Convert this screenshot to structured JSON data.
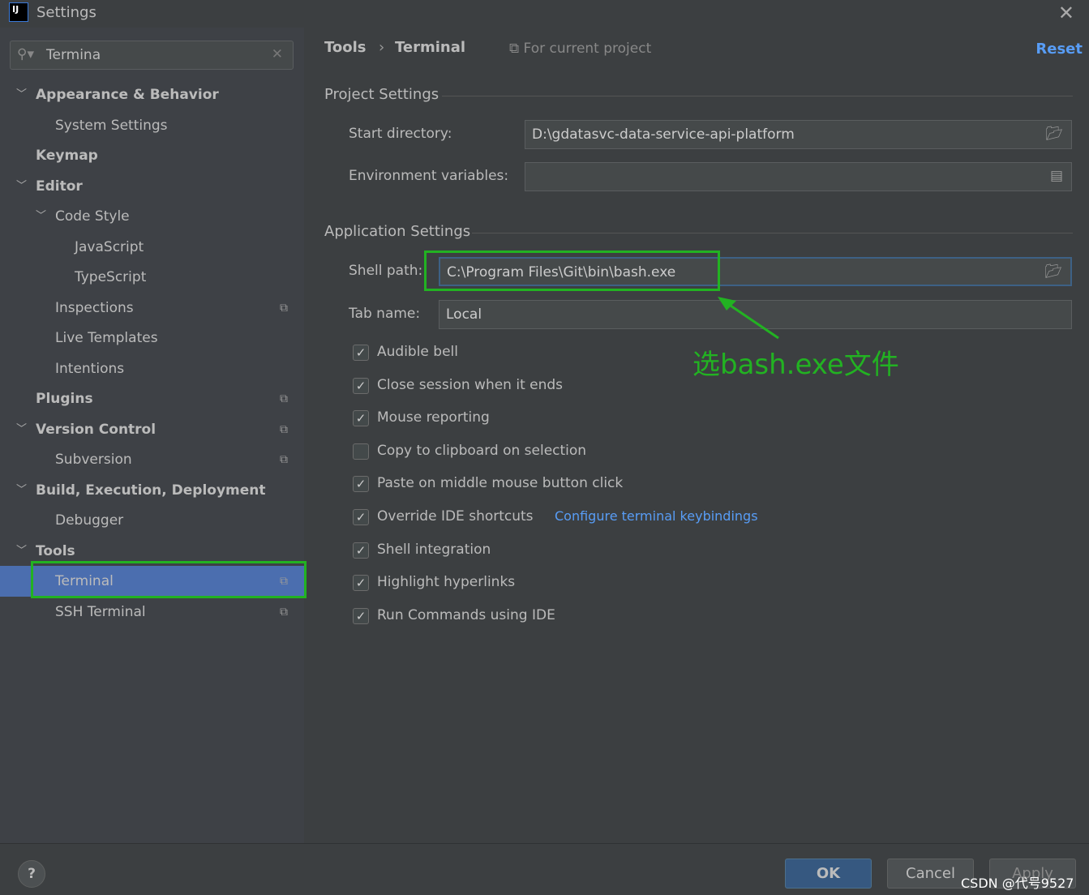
{
  "window": {
    "title": "Settings",
    "logo": "IJ"
  },
  "search": {
    "value": "Termina"
  },
  "tree": [
    {
      "label": "Appearance & Behavior",
      "level": 0,
      "expanded": true,
      "bold": true
    },
    {
      "label": "System Settings",
      "level": 1
    },
    {
      "label": "Keymap",
      "level": 0,
      "bold": true
    },
    {
      "label": "Editor",
      "level": 0,
      "expanded": true,
      "bold": true
    },
    {
      "label": "Code Style",
      "level": 1,
      "expanded": true
    },
    {
      "label": "JavaScript",
      "level": 2
    },
    {
      "label": "TypeScript",
      "level": 2
    },
    {
      "label": "Inspections",
      "level": 1,
      "copy": true
    },
    {
      "label": "Live Templates",
      "level": 1
    },
    {
      "label": "Intentions",
      "level": 1
    },
    {
      "label": "Plugins",
      "level": 0,
      "bold": true,
      "copy": true
    },
    {
      "label": "Version Control",
      "level": 0,
      "expanded": true,
      "bold": true,
      "copy": true
    },
    {
      "label": "Subversion",
      "level": 1,
      "copy": true
    },
    {
      "label": "Build, Execution, Deployment",
      "level": 0,
      "expanded": true,
      "bold": true
    },
    {
      "label": "Debugger",
      "level": 1
    },
    {
      "label": "Tools",
      "level": 0,
      "expanded": true,
      "bold": true
    },
    {
      "label": "Terminal",
      "level": 1,
      "copy": true,
      "selected": true
    },
    {
      "label": "SSH Terminal",
      "level": 1,
      "copy": true
    }
  ],
  "header": {
    "crumb1": "Tools",
    "sep": "›",
    "crumb2": "Terminal",
    "scope": "For current project",
    "reset": "Reset"
  },
  "project": {
    "title": "Project Settings",
    "start_label": "Start directory:",
    "start_value": "D:\\gdatasvc-data-service-api-platform",
    "env_label": "Environment variables:",
    "env_value": ""
  },
  "app": {
    "title": "Application Settings",
    "shell_label": "Shell path:",
    "shell_value": "C:\\Program Files\\Git\\bin\\bash.exe",
    "tab_label": "Tab name:",
    "tab_value": "Local"
  },
  "checkboxes": [
    {
      "label": "Audible bell",
      "checked": true
    },
    {
      "label": "Close session when it ends",
      "checked": true
    },
    {
      "label": "Mouse reporting",
      "checked": true
    },
    {
      "label": "Copy to clipboard on selection",
      "checked": false
    },
    {
      "label": "Paste on middle mouse button click",
      "checked": true
    },
    {
      "label": "Override IDE shortcuts",
      "checked": true
    },
    {
      "label": "Shell integration",
      "checked": true
    },
    {
      "label": "Highlight hyperlinks",
      "checked": true
    },
    {
      "label": "Run Commands using IDE",
      "checked": true
    }
  ],
  "keybindings_link": "Configure terminal keybindings",
  "annotation": {
    "text": "选bash.exe文件",
    "color": "#22b222"
  },
  "footer": {
    "help": "?",
    "ok": "OK",
    "cancel": "Cancel",
    "apply": "Apply",
    "watermark": "CSDN @代号9527"
  },
  "colors": {
    "selection": "#4b6eaf",
    "highlight": "#22b222",
    "link": "#589df6"
  }
}
